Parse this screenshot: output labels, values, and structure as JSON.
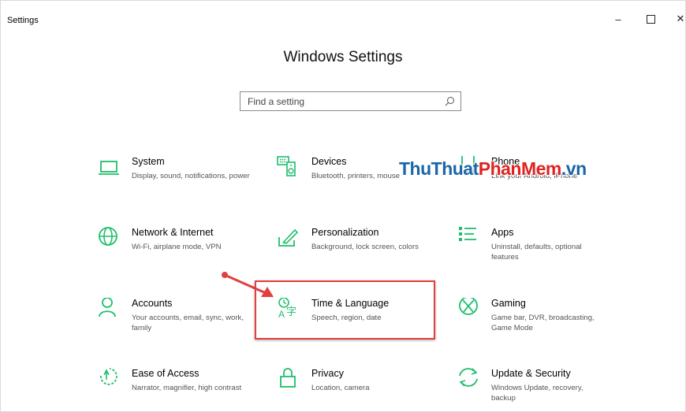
{
  "window": {
    "title": "Settings"
  },
  "controls": {
    "minimize": "–",
    "close": "✕"
  },
  "page": {
    "title": "Windows Settings"
  },
  "search": {
    "placeholder": "Find a setting"
  },
  "watermark": {
    "part1": "ThuThuat",
    "part2": "PhanMem",
    "part3": ".vn"
  },
  "tiles": [
    {
      "name": "System",
      "desc": "Display, sound, notifications, power",
      "icon": "laptop-icon"
    },
    {
      "name": "Devices",
      "desc": "Bluetooth, printers, mouse",
      "icon": "keyboard-speaker-icon"
    },
    {
      "name": "Phone",
      "desc": "Link your Android, iPhone",
      "icon": "phone-icon"
    },
    {
      "name": "Network & Internet",
      "desc": "Wi-Fi, airplane mode, VPN",
      "icon": "globe-icon"
    },
    {
      "name": "Personalization",
      "desc": "Background, lock screen, colors",
      "icon": "paint-brush-icon"
    },
    {
      "name": "Apps",
      "desc": "Uninstall, defaults, optional features",
      "icon": "apps-list-icon"
    },
    {
      "name": "Accounts",
      "desc": "Your accounts, email, sync, work, family",
      "icon": "person-icon"
    },
    {
      "name": "Time & Language",
      "desc": "Speech, region, date",
      "icon": "time-language-icon"
    },
    {
      "name": "Gaming",
      "desc": "Game bar, DVR, broadcasting, Game Mode",
      "icon": "xbox-icon"
    },
    {
      "name": "Ease of Access",
      "desc": "Narrator, magnifier, high contrast",
      "icon": "ease-of-access-icon"
    },
    {
      "name": "Privacy",
      "desc": "Location, camera",
      "icon": "lock-icon"
    },
    {
      "name": "Update & Security",
      "desc": "Windows Update, recovery, backup",
      "icon": "sync-arrows-icon"
    }
  ],
  "colors": {
    "accent": "#1ebf6b",
    "highlight": "#e0403f"
  }
}
